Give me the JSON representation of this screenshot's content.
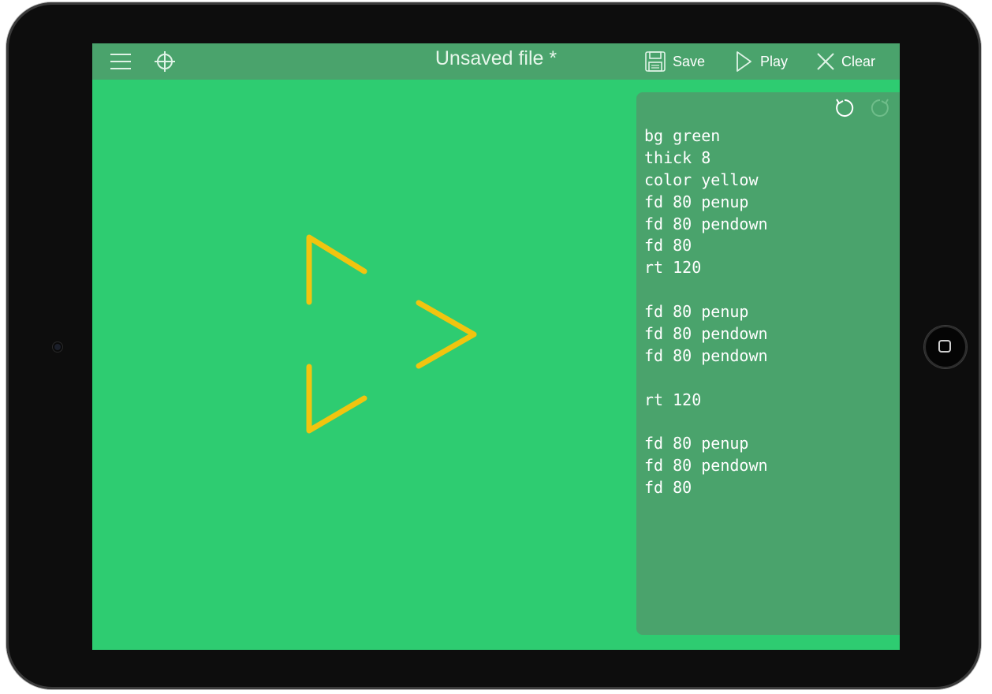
{
  "toolbar": {
    "title": "Unsaved file *",
    "save_label": "Save",
    "play_label": "Play",
    "clear_label": "Clear",
    "icons": [
      "menu-icon",
      "crosshair-icon",
      "floppy-disk-icon",
      "play-icon",
      "close-icon"
    ]
  },
  "editor": {
    "icons": [
      "undo-icon",
      "redo-icon"
    ],
    "lines": [
      "bg green",
      "thick 8",
      "color yellow",
      "fd 80 penup",
      "fd 80 pendown",
      "fd 80",
      "rt 120",
      "",
      "fd 80 penup",
      "fd 80 pendown",
      "fd 80 pendown",
      "",
      "rt 120",
      "",
      "fd 80 penup",
      "fd 80 pendown",
      "fd 80"
    ]
  },
  "colors": {
    "canvas_background": "#2ecc71",
    "toolbar_background": "#4aa36c",
    "pen_color": "#f1c40f",
    "device_frame": "#0d0d0d"
  }
}
